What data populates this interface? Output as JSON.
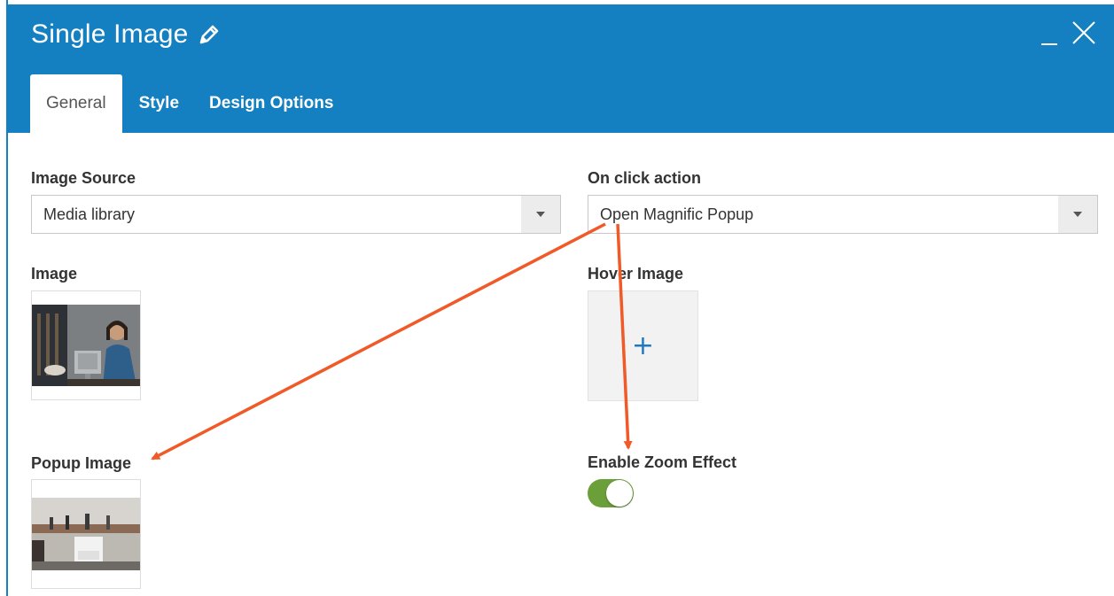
{
  "dialog": {
    "title": "Single Image",
    "title_icon": "pencil-icon",
    "minimize_glyph": "_",
    "close_icon": "close-icon"
  },
  "tabs": [
    {
      "label": "General",
      "active": true
    },
    {
      "label": "Style",
      "active": false
    },
    {
      "label": "Design Options",
      "active": false
    }
  ],
  "fields": {
    "image_source": {
      "label": "Image Source",
      "value": "Media library"
    },
    "on_click_action": {
      "label": "On click action",
      "value": "Open Magnific Popup"
    },
    "image": {
      "label": "Image"
    },
    "hover_image": {
      "label": "Hover Image",
      "add_glyph": "+"
    },
    "popup_image": {
      "label": "Popup Image"
    },
    "enable_zoom_effect": {
      "label": "Enable Zoom Effect",
      "enabled": true
    }
  },
  "colors": {
    "header": "#1480c1",
    "toggle_on": "#6b9f3a",
    "annotation_arrow": "#f05a28",
    "plus": "#1f78c1"
  }
}
